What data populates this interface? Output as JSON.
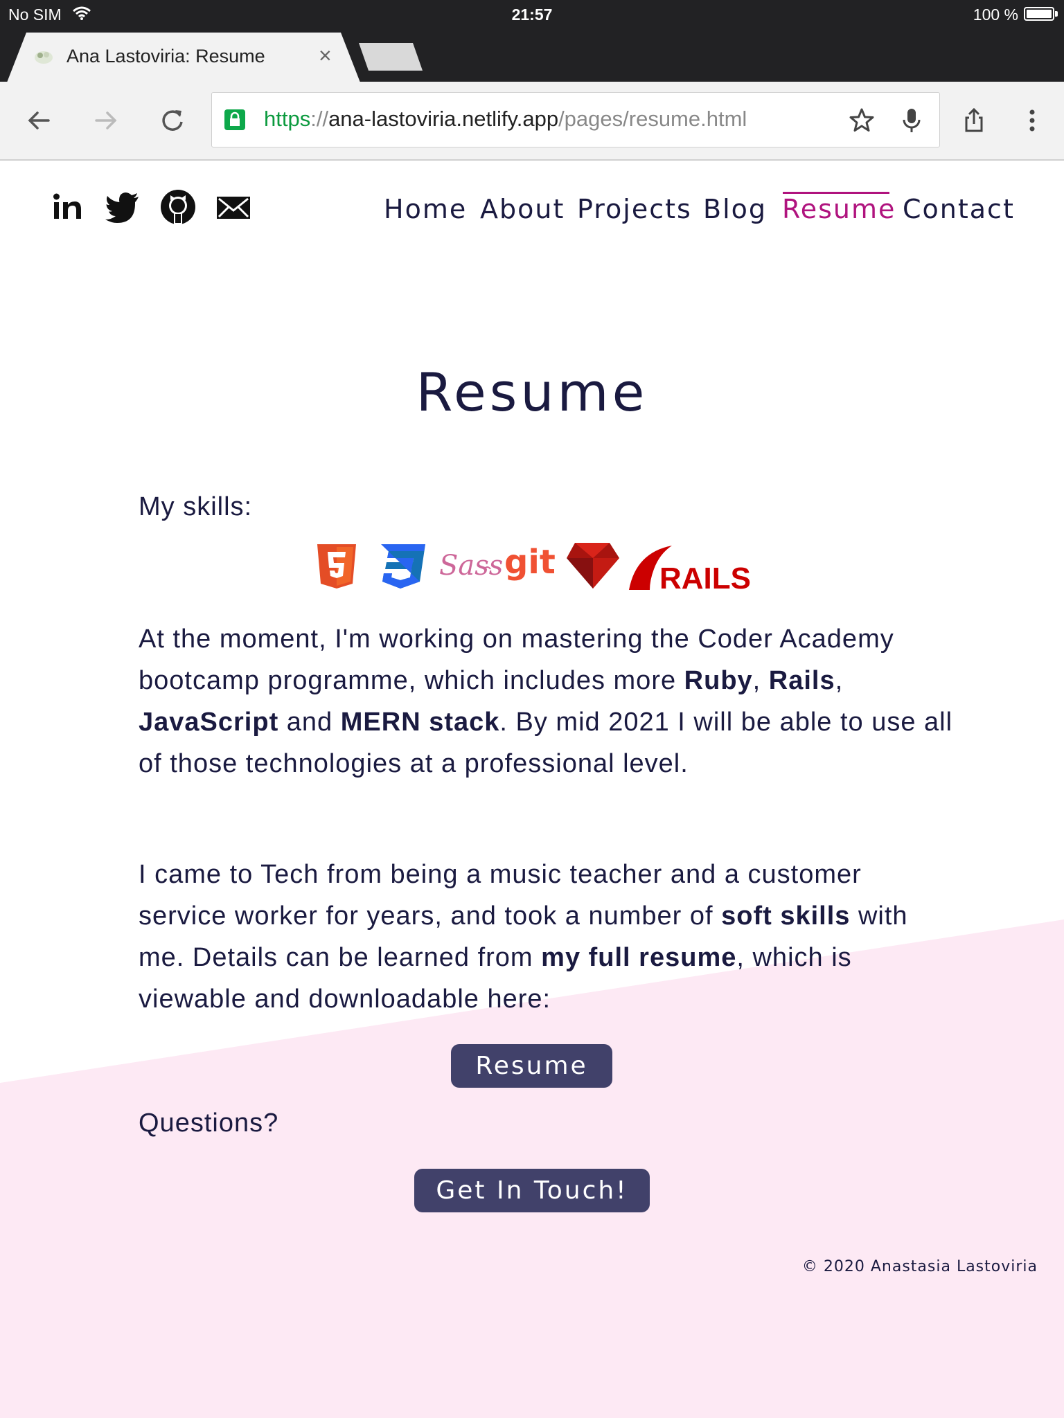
{
  "status_bar": {
    "carrier": "No SIM",
    "time": "21:57",
    "battery": "100 %"
  },
  "browser": {
    "tab_title": "Ana Lastoviria: Resume",
    "url": {
      "scheme": "https",
      "separator": "://",
      "host": "ana-lastoviria.netlify.app",
      "path": "/pages/resume.html"
    }
  },
  "site": {
    "social": [
      "linkedin-icon",
      "twitter-icon",
      "github-icon",
      "mail-icon"
    ],
    "nav": {
      "home": "Home",
      "about": "About",
      "projects": "Projects",
      "blog": "Blog",
      "resume": "Resume",
      "contact": "Contact",
      "active": "Resume"
    },
    "accent_color": "#b0137e",
    "text_color": "#1a1a40",
    "button_color": "#41416a",
    "background_band_color": "#fde9f4"
  },
  "main": {
    "title": "Resume",
    "skills_label": "My skills:",
    "skills": [
      "html5",
      "css3",
      "sass",
      "git",
      "ruby",
      "rails"
    ],
    "para1": {
      "t1": "At the moment, I'm working on mastering the Coder Academy bootcamp programme, which includes more ",
      "ruby": "Ruby",
      "c1": ", ",
      "rails": "Rails",
      "c2": ", ",
      "javascript": "JavaScript",
      "and": " and ",
      "mern": "MERN stack",
      "t2": ". By mid 2021 I will be able to use all of those technologies at a professional level."
    },
    "para2": {
      "t1": "I came to Tech from being a music teacher and a customer service worker for years, and took a number of ",
      "soft_skills": "soft skills",
      "t2": " with me. Details can be learned from ",
      "full_resume": "my full resume",
      "t3": ", which is viewable and downloadable here:"
    },
    "resume_button": "Resume",
    "questions": "Questions?",
    "contact_button": "Get In Touch!"
  },
  "footer": {
    "copyright": "© 2020 Anastasia Lastoviria"
  }
}
